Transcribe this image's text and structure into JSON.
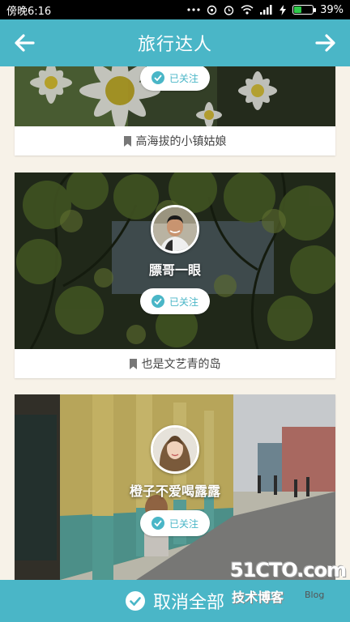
{
  "status_bar": {
    "time": "傍晚6:16",
    "icons": [
      "dots-icon",
      "sync-icon",
      "alarm-icon",
      "wifi-icon",
      "signal-icon",
      "charging-icon"
    ],
    "battery_percent": 39,
    "battery_text": "39%"
  },
  "app_bar": {
    "title": "旅行达人",
    "back_icon": "arrow-left-icon",
    "forward_icon": "arrow-right-icon",
    "color": "#4ab6c7"
  },
  "cards": [
    {
      "username": "",
      "follow_label": "已关注",
      "caption": "高海拔的小镇姑娘"
    },
    {
      "username": "膘哥一眼",
      "follow_label": "已关注",
      "caption": "也是文艺青的岛"
    },
    {
      "username": "橙子不爱喝露露",
      "follow_label": "已关注",
      "caption": ""
    }
  ],
  "bottom_bar": {
    "label": "取消全部"
  },
  "watermark": {
    "main": "51CTO.com",
    "sub": "技术博客",
    "tag": "Blog"
  }
}
